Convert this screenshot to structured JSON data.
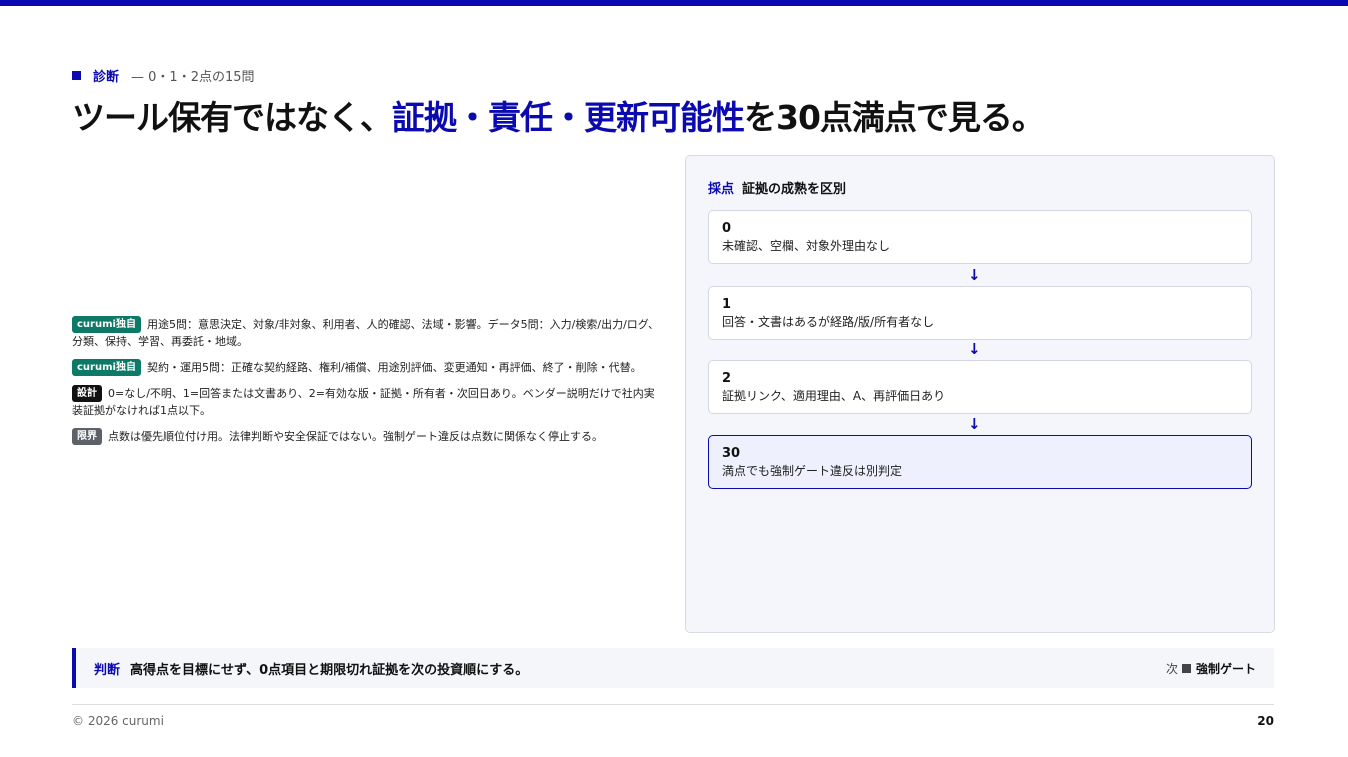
{
  "eyebrow": {
    "label": "診断",
    "sub": "— 0・1・2点の15問"
  },
  "headline": {
    "prefix": "ツール保有ではなく、",
    "highlight": "証拠・責任・更新可能性",
    "suffix": "を30点満点で見る。"
  },
  "notes": [
    {
      "tag": "curumi独自",
      "text": "用途5問：意思決定、対象/非対象、利用者、人的確認、法域・影響。データ5問：入力/検索/出力/ログ、分類、保持、学習、再委託・地域。"
    },
    {
      "tag": "curumi独自",
      "text": "契約・運用5問：正確な契約経路、権利/補償、用途別評価、変更通知・再評価、終了・削除・代替。"
    },
    {
      "tag": "設計",
      "text": "0=なし/不明、1=回答または文書あり、2=有効な版・証拠・所有者・次回日あり。ベンダー説明だけで社内実装証拠がなければ1点以下。"
    },
    {
      "tag": "限界",
      "text": "点数は優先順位付け用。法律判断や安全保証ではない。強制ゲート違反は点数に関係なく停止する。"
    }
  ],
  "panel": {
    "key": "採点",
    "title": "証拠の成熟を区別",
    "arrow": "↓",
    "steps": [
      {
        "n": "0",
        "d": "未確認、空欄、対象外理由なし"
      },
      {
        "n": "1",
        "d": "回答・文書はあるが経路/版/所有者なし"
      },
      {
        "n": "2",
        "d": "証拠リンク、適用理由、A、再評価日あり"
      },
      {
        "n": "30",
        "d": "満点でも強制ゲート違反は別判定"
      }
    ]
  },
  "verdict": {
    "key": "判断",
    "text": "高得点を目標にせず、0点項目と期限切れ証拠を次の投資順にする。",
    "next_label": "次",
    "next_target": "強制ゲート"
  },
  "footer": {
    "copyright": "© 2026 curumi",
    "page": "20"
  },
  "colors": {
    "accent": "#0a0ab0",
    "tag_green": "#0c7a66"
  }
}
